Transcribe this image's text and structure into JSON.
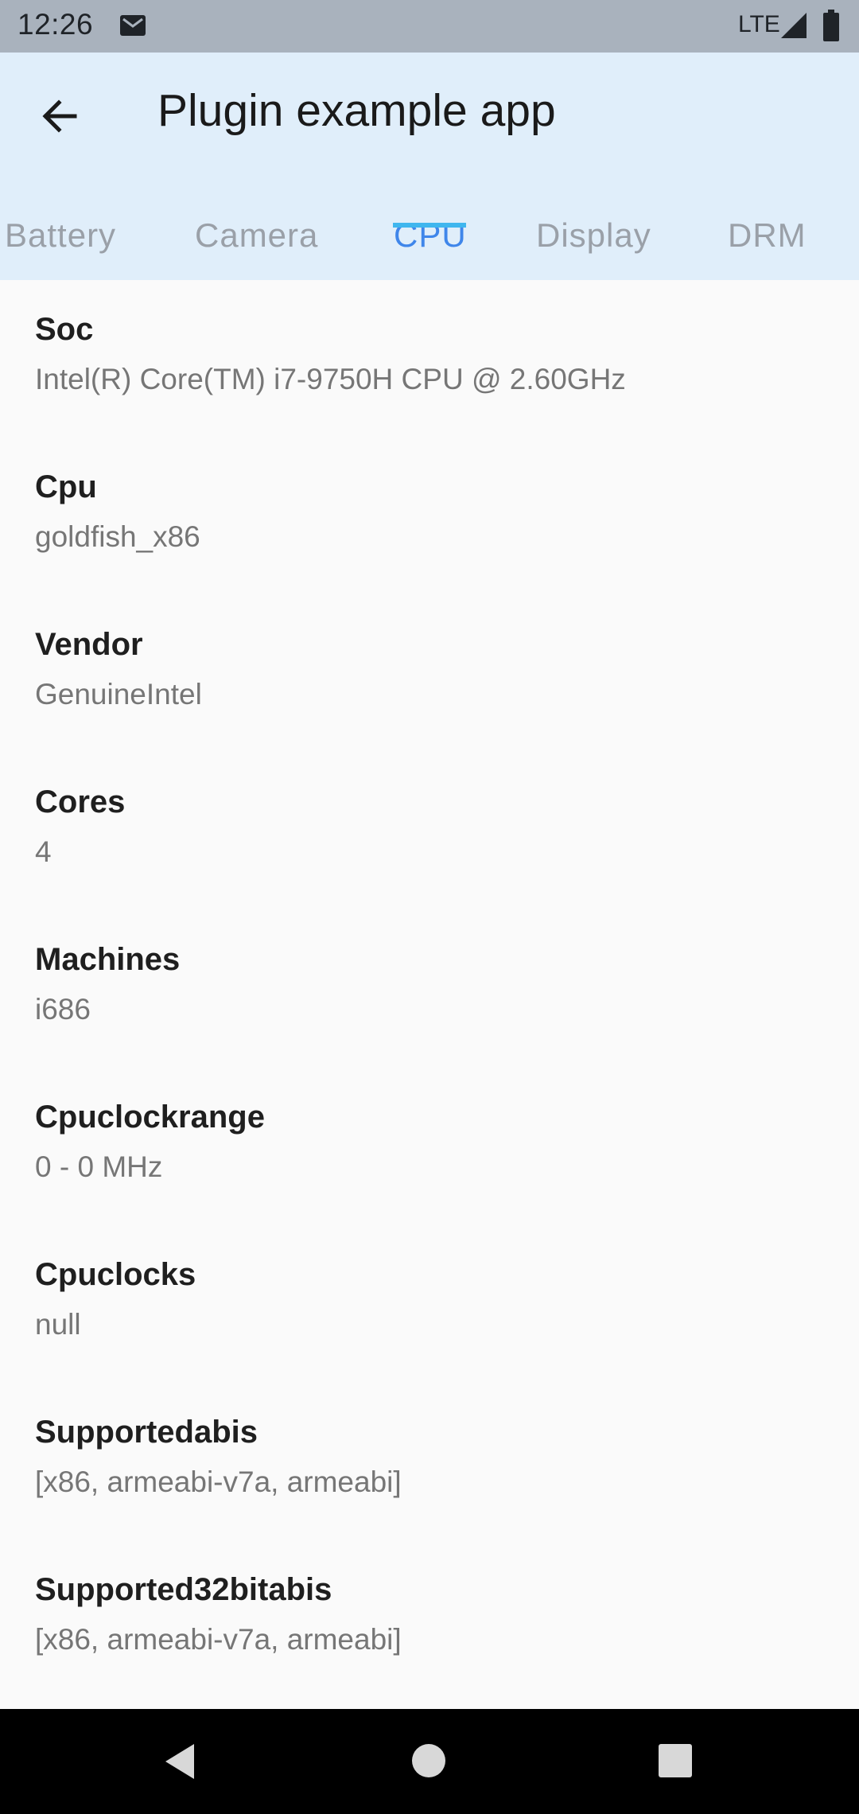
{
  "status_bar": {
    "time": "12:26",
    "network": "LTE",
    "icons": [
      "gmail-icon",
      "signal-icon",
      "battery-icon"
    ]
  },
  "app_bar": {
    "title": "Plugin example app",
    "back_icon": "arrow-back-icon"
  },
  "tabs": [
    {
      "label": "Battery",
      "active": false
    },
    {
      "label": "Camera",
      "active": false
    },
    {
      "label": "CPU",
      "active": true
    },
    {
      "label": "Display",
      "active": false
    },
    {
      "label": "DRM",
      "active": false
    }
  ],
  "info": [
    {
      "label": "Soc",
      "value": "Intel(R) Core(TM) i7-9750H CPU @ 2.60GHz"
    },
    {
      "label": "Cpu",
      "value": "goldfish_x86"
    },
    {
      "label": "Vendor",
      "value": "GenuineIntel"
    },
    {
      "label": "Cores",
      "value": "4"
    },
    {
      "label": "Machines",
      "value": "i686"
    },
    {
      "label": "Cpuclockrange",
      "value": "0 - 0 MHz"
    },
    {
      "label": "Cpuclocks",
      "value": "null"
    },
    {
      "label": "Supportedabis",
      "value": "[x86, armeabi-v7a, armeabi]"
    },
    {
      "label": "Supported32bitabis",
      "value": "[x86, armeabi-v7a, armeabi]"
    }
  ],
  "colors": {
    "app_bar_bg": "#e0eefa",
    "active_tab": "#3f86ea",
    "tab_indicator": "#3fb6ee",
    "inactive_tab": "#9aa0a8"
  },
  "nav_bar": {
    "icons": [
      "nav-back-icon",
      "nav-home-icon",
      "nav-recents-icon"
    ]
  }
}
